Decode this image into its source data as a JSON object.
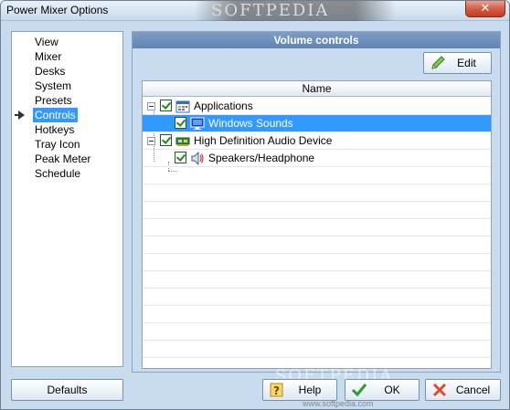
{
  "window": {
    "title": "Power Mixer Options",
    "close_label": "✕",
    "watermark": "SOFTPEDIA"
  },
  "nav": {
    "items": [
      {
        "label": "View"
      },
      {
        "label": "Mixer"
      },
      {
        "label": "Desks"
      },
      {
        "label": "System"
      },
      {
        "label": "Presets"
      },
      {
        "label": "Controls",
        "selected": true
      },
      {
        "label": "Hotkeys"
      },
      {
        "label": "Tray Icon"
      },
      {
        "label": "Peak Meter"
      },
      {
        "label": "Schedule"
      }
    ]
  },
  "panel": {
    "header": "Volume controls",
    "edit_label": "Edit",
    "column_name": "Name",
    "tree": [
      {
        "label": "Applications",
        "level": 0,
        "checked": true,
        "icon": "applications-icon"
      },
      {
        "label": "Windows Sounds",
        "level": 1,
        "checked": true,
        "icon": "monitor-icon",
        "selected": true
      },
      {
        "label": "High Definition Audio Device",
        "level": 0,
        "checked": true,
        "icon": "sound-card-icon"
      },
      {
        "label": "Speakers/Headphone",
        "level": 1,
        "checked": true,
        "icon": "speaker-icon"
      }
    ]
  },
  "footer": {
    "defaults_label": "Defaults",
    "help_label": "Help",
    "ok_label": "OK",
    "cancel_label": "Cancel",
    "watermark": "SOFTPEDIA",
    "watermark_url": "www.softpedia.com"
  },
  "colors": {
    "selection": "#3399ff",
    "panel_header": "#6a8dbb",
    "window_bg": "#c9dbee"
  }
}
